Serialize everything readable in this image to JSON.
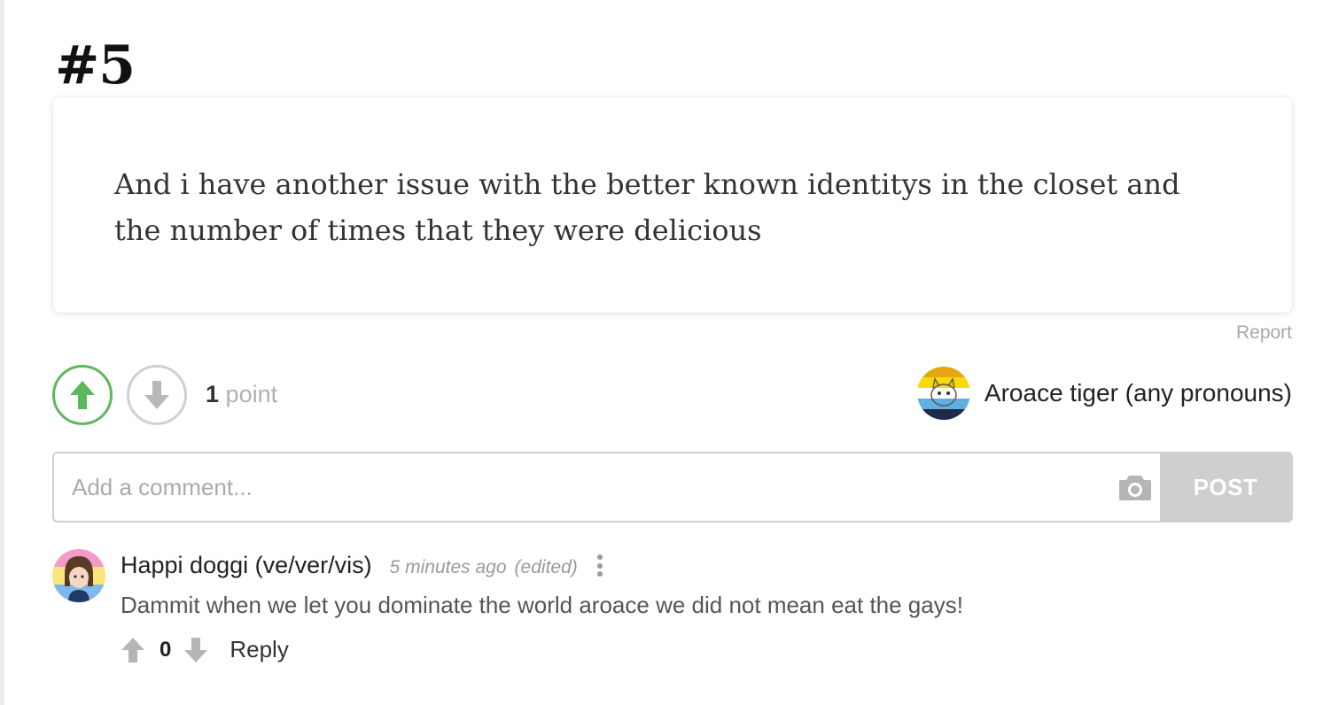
{
  "post": {
    "number": "#5",
    "text": "And i have another issue with the better known identitys in the closet and the number of times that they were delicious",
    "report_label": "Report",
    "points_count": "1",
    "points_label": "point",
    "author_name": "Aroace tiger (any pronouns)"
  },
  "comment_form": {
    "placeholder": "Add a comment...",
    "post_label": "POST"
  },
  "comments": [
    {
      "author": "Happi doggi (ve/ver/vis)",
      "time": "5 minutes ago",
      "edited": "(edited)",
      "text": "Dammit when we let you dominate the world aroace we did not mean eat the gays!",
      "score": "0",
      "reply_label": "Reply"
    }
  ],
  "colors": {
    "upvote_active": "#5cb85c",
    "vote_inactive": "#d0d0d0",
    "post_button_bg": "#cfcfcf"
  },
  "icons": [
    "arrow-up-icon",
    "arrow-down-icon",
    "camera-icon",
    "more-vertical-icon"
  ]
}
